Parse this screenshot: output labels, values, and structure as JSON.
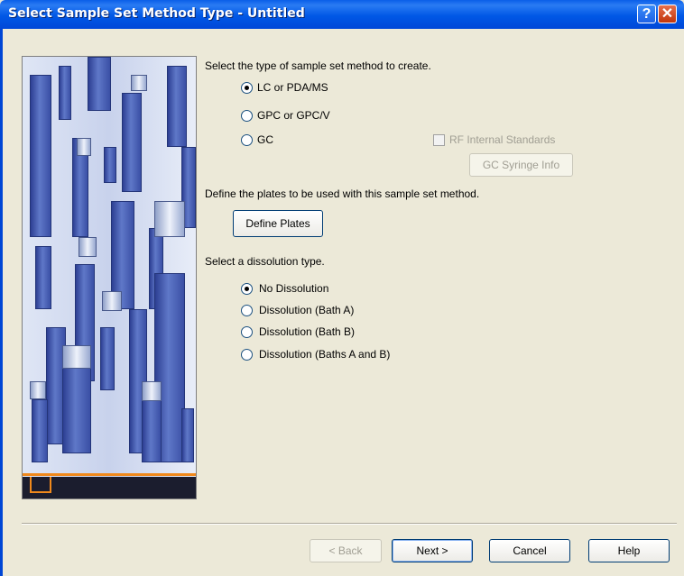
{
  "window": {
    "title": "Select Sample Set Method Type - Untitled",
    "help_glyph": "?",
    "close_glyph": "✕"
  },
  "method": {
    "prompt": "Select the type of sample set method to create.",
    "options": [
      "LC or PDA/MS",
      "GPC or GPC/V",
      "GC"
    ],
    "selected": "LC or PDA/MS",
    "rf_internal_standards": "RF Internal Standards",
    "gc_syringe_info": "GC Syringe Info"
  },
  "plates": {
    "prompt": "Define the plates to be used with this sample set method.",
    "button": "Define Plates"
  },
  "dissolution": {
    "prompt": "Select a dissolution type.",
    "options": [
      "No Dissolution",
      "Dissolution (Bath A)",
      "Dissolution (Bath B)",
      "Dissolution (Baths A and B)"
    ],
    "selected": "No Dissolution"
  },
  "footer": {
    "back": "< Back",
    "next": "Next >",
    "cancel": "Cancel",
    "help": "Help"
  },
  "colors": {
    "titlebar": "#0058e6",
    "dialog_bg": "#ece9d8",
    "accent_orange": "#f0891c"
  }
}
